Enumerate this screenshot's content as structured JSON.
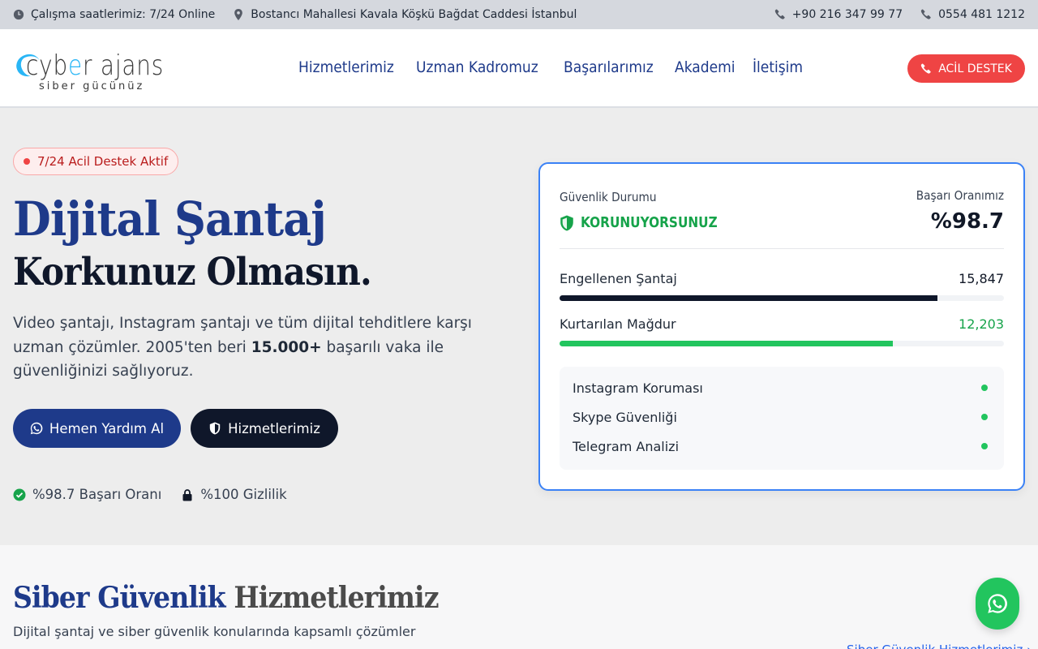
{
  "topbar": {
    "hours": "Çalışma saatlerimiz: 7/24 Online",
    "address": "Bostancı Mahallesi Kavala Köşkü Bağdat Caddesi İstanbul",
    "phone1": "+90 216 347 99 77",
    "phone2": "0554 481 1212"
  },
  "logo": {
    "main_a": "cyb",
    "main_b": "e",
    "main_c": "r ajans",
    "sub": "siber gücünüz"
  },
  "nav": [
    "Hizmetlerimiz",
    "Uzman Kadromuz",
    "Başarılarımız",
    "Akademi",
    "İletişim"
  ],
  "emergency_button": "ACİL DESTEK",
  "hero": {
    "badge": "7/24 Acil Destek Aktif",
    "title_line1": "Dijital Şantaj",
    "title_line2": "Korkunuz Olmasın.",
    "desc_part1": "Video şantajı, Instagram şantajı ve tüm dijital tehditlere karşı uzman çözümler. 2005'ten beri ",
    "desc_bold": "15.000+",
    "desc_part2": " başarılı vaka ile güvenliğinizi sağlıyoruz.",
    "btn_help": "Hemen Yardım Al",
    "btn_services": "Hizmetlerimiz",
    "feature1": "%98.7 Başarı Oranı",
    "feature2": "%100 Gizlilik"
  },
  "card": {
    "status_label": "Güvenlik Durumu",
    "status_value": "KORUNUYORSUNUZ",
    "rate_label": "Başarı Oranımız",
    "rate_value": "%98.7",
    "stats": [
      {
        "label": "Engellenen Şantaj",
        "value": "15,847",
        "fill_pct": 85,
        "color": "#0f172a"
      },
      {
        "label": "Kurtarılan Mağdur",
        "value": "12,203",
        "fill_pct": 75,
        "color": "#22c55e"
      }
    ],
    "services": [
      "Instagram Koruması",
      "Skype Güvenliği",
      "Telegram Analizi"
    ]
  },
  "services_section": {
    "title_a": "Siber Güvenlik",
    "title_b": "Hizmetlerimiz",
    "subtitle": "Dijital şantaj ve siber güvenlik konularında kapsamlı çözümler",
    "link": "Siber Güvenlik Hizmetlerimiz"
  },
  "colors": {
    "primary": "#1e3a8a",
    "danger": "#ef4444",
    "success": "#22c55e",
    "dark": "#0f172a"
  },
  "icons": [
    "clock-icon",
    "location-icon",
    "phone-icon",
    "shield-icon",
    "whatsapp-icon",
    "check-circle-icon",
    "lock-icon",
    "chevron-right-icon"
  ]
}
